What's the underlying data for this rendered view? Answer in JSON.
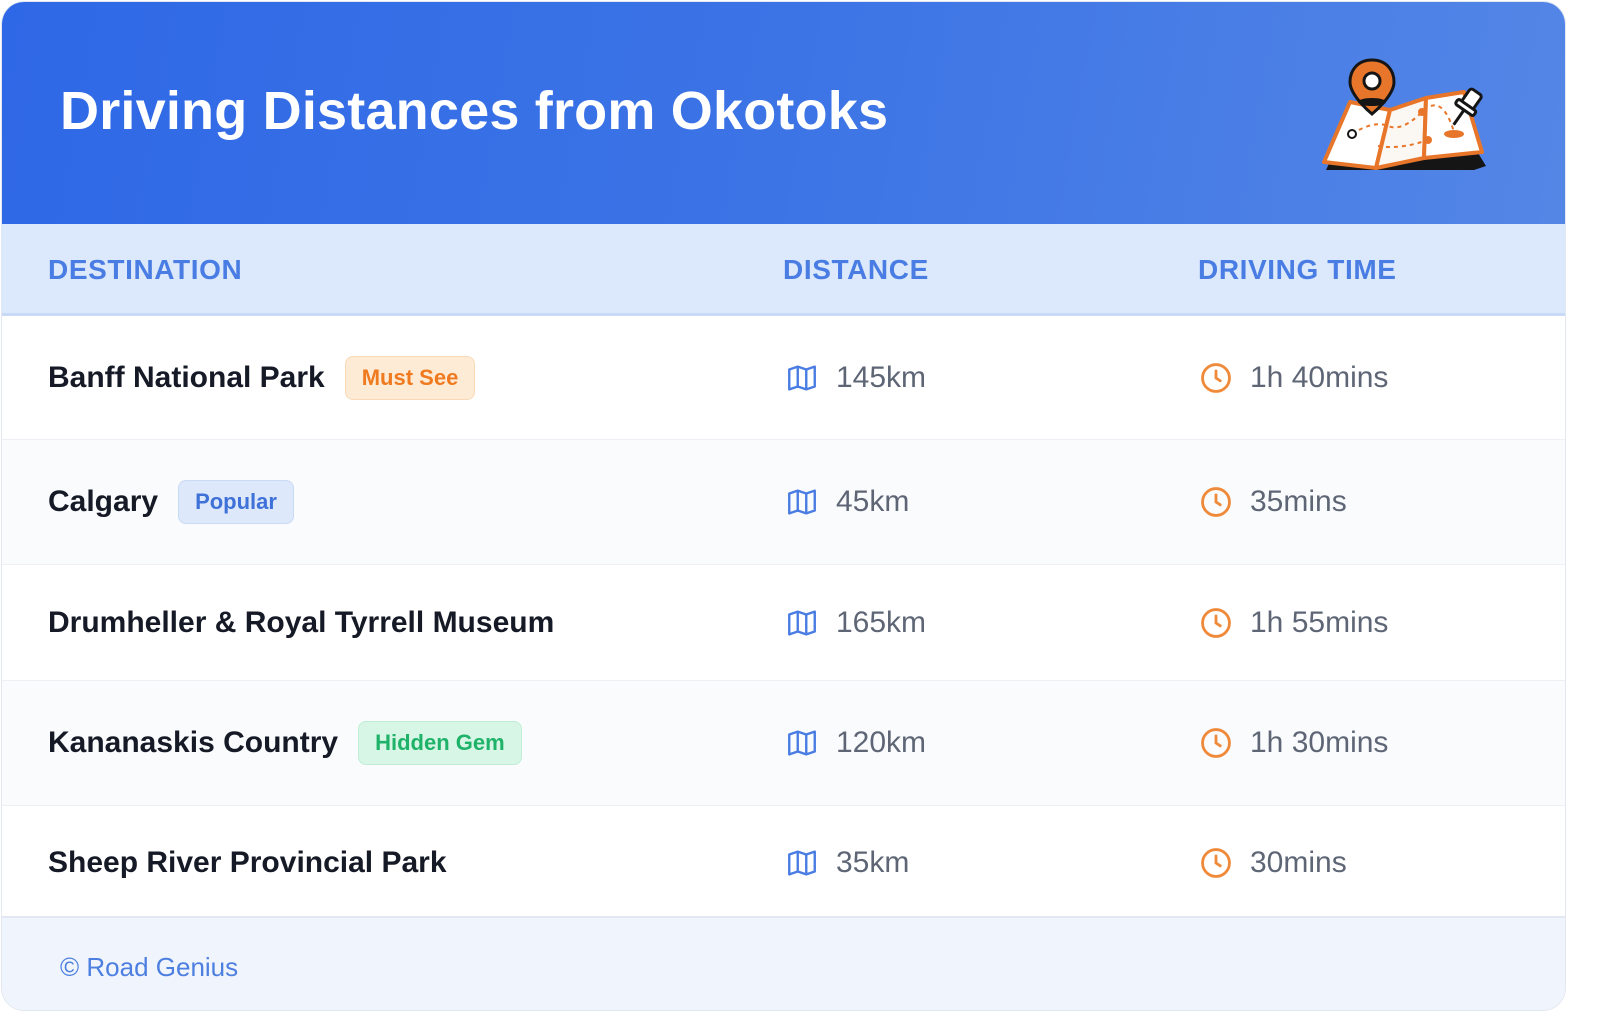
{
  "header": {
    "title": "Driving Distances from Okotoks",
    "illustration_icon": "map-with-pins"
  },
  "columns": {
    "destination": "DESTINATION",
    "distance": "DISTANCE",
    "driving_time": "DRIVING TIME"
  },
  "rows": [
    {
      "destination": "Banff National Park",
      "badge": "Must See",
      "badge_color": "#ef7a1f",
      "distance": "145km",
      "time": "1h 40mins"
    },
    {
      "destination": "Calgary",
      "badge": "Popular",
      "badge_color": "#3f72d8",
      "distance": "45km",
      "time": "35mins"
    },
    {
      "destination": "Drumheller & Royal Tyrrell Museum",
      "badge": null,
      "distance": "165km",
      "time": "1h 55mins"
    },
    {
      "destination": "Kananaskis Country",
      "badge": "Hidden Gem",
      "badge_color": "#1fb36a",
      "distance": "120km",
      "time": "1h 30mins"
    },
    {
      "destination": "Sheep River Provincial Park",
      "badge": null,
      "distance": "35km",
      "time": "30mins"
    }
  ],
  "icons": {
    "distance": "map-icon",
    "time": "clock-icon"
  },
  "colors": {
    "header_blue": "#2f68e6",
    "accent_orange": "#ef7a1f",
    "map_icon_blue": "#4a7de3"
  },
  "footer": {
    "credit": "© Road Genius"
  }
}
